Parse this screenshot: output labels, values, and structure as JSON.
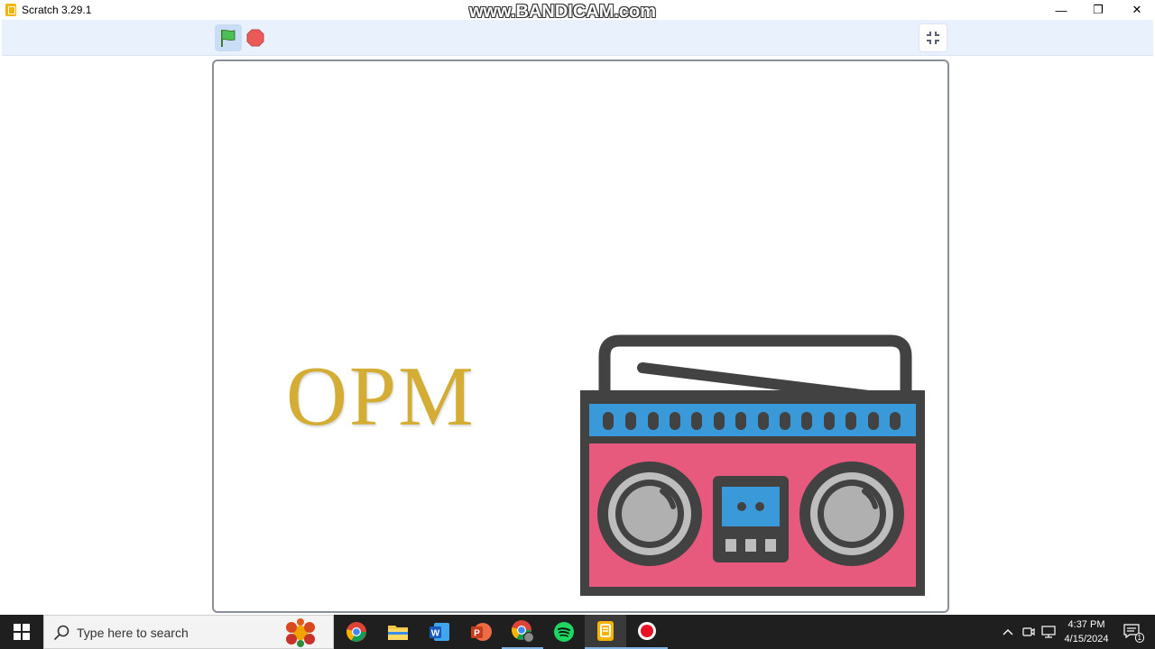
{
  "window": {
    "title": "Scratch 3.29.1",
    "watermark": "www.BANDICAM.com",
    "controls": {
      "minimize": "—",
      "restore": "❐",
      "close": "✕"
    }
  },
  "toolbar": {
    "green_flag": "flag-icon",
    "stop": "stop-icon",
    "fullscreen": "unfullscreen-icon"
  },
  "stage": {
    "opm_text": "OPM",
    "sprite": "boombox-radio",
    "colors": {
      "opm": "#d4ad35",
      "radio_body": "#e85a7d",
      "radio_band": "#3a9ad9",
      "radio_outline": "#424242"
    }
  },
  "taskbar": {
    "search_placeholder": "Type here to search",
    "apps": [
      "chrome-icon",
      "file-explorer-icon",
      "word-icon",
      "powerpoint-icon",
      "chrome-profile-icon",
      "spotify-icon",
      "scratch-icon",
      "bandicam-icon"
    ],
    "time": "4:37 PM",
    "date": "4/15/2024",
    "notification_count": "1"
  }
}
